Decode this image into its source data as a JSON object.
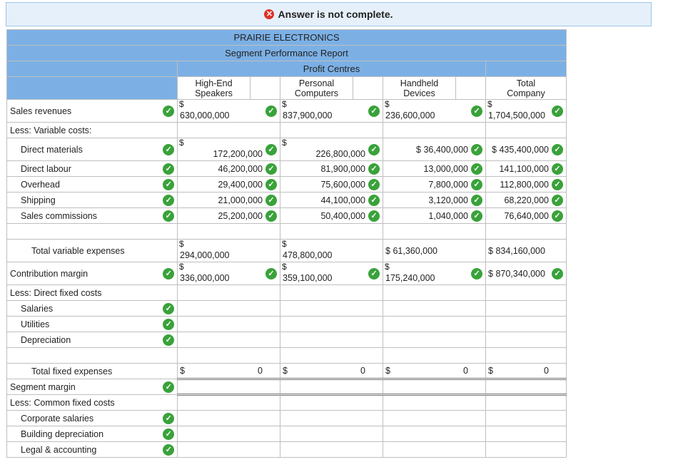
{
  "banner": {
    "text": "Answer is not complete."
  },
  "report": {
    "company": "PRAIRIE ELECTRONICS",
    "title": "Segment Performance Report",
    "profit_centres": "Profit Centres",
    "columns": [
      {
        "line1": "High-End",
        "line2": "Speakers"
      },
      {
        "line1": "Personal",
        "line2": "Computers"
      },
      {
        "line1": "Handheld",
        "line2": "Devices"
      },
      {
        "line1": "Total",
        "line2": "Company"
      }
    ],
    "currency": "$",
    "rows": {
      "sales": {
        "label": "Sales revenues",
        "values": [
          "630,000,000",
          "837,900,000",
          "236,600,000",
          "1,704,500,000"
        ]
      },
      "less_var": {
        "label": "Less: Variable costs:"
      },
      "dm": {
        "label": "Direct materials",
        "values": [
          "172,200,000",
          "226,800,000",
          "36,400,000",
          "435,400,000"
        ]
      },
      "dl": {
        "label": "Direct labour",
        "values": [
          "46,200,000",
          "81,900,000",
          "13,000,000",
          "141,100,000"
        ]
      },
      "oh": {
        "label": "Overhead",
        "values": [
          "29,400,000",
          "75,600,000",
          "7,800,000",
          "112,800,000"
        ]
      },
      "sh": {
        "label": "Shipping",
        "values": [
          "21,000,000",
          "44,100,000",
          "3,120,000",
          "68,220,000"
        ]
      },
      "sc": {
        "label": "Sales commissions",
        "values": [
          "25,200,000",
          "50,400,000",
          "1,040,000",
          "76,640,000"
        ]
      },
      "tve": {
        "label": "Total variable expenses",
        "values": [
          "294,000,000",
          "478,800,000",
          "61,360,000",
          "834,160,000"
        ]
      },
      "cm": {
        "label": "Contribution margin",
        "values": [
          "336,000,000",
          "359,100,000",
          "175,240,000",
          "870,340,000"
        ]
      },
      "less_fixed": {
        "label": "Less: Direct fixed costs"
      },
      "sal": {
        "label": "Salaries"
      },
      "util": {
        "label": "Utilities"
      },
      "dep": {
        "label": "Depreciation"
      },
      "tfe": {
        "label": "Total fixed expenses",
        "values": [
          "0",
          "0",
          "0",
          "0"
        ]
      },
      "sm": {
        "label": "Segment margin"
      },
      "less_common": {
        "label": "Less: Common fixed costs"
      },
      "cs": {
        "label": "Corporate salaries"
      },
      "bd": {
        "label": "Building depreciation"
      },
      "la": {
        "label": "Legal & accounting"
      }
    }
  },
  "icons": {
    "check": "check-circle-icon",
    "error": "x-circle-icon"
  },
  "colors": {
    "header_bg": "#7cb0e5",
    "banner_bg": "#e6f0fa",
    "check": "#39a23a",
    "error": "#d9342b"
  }
}
